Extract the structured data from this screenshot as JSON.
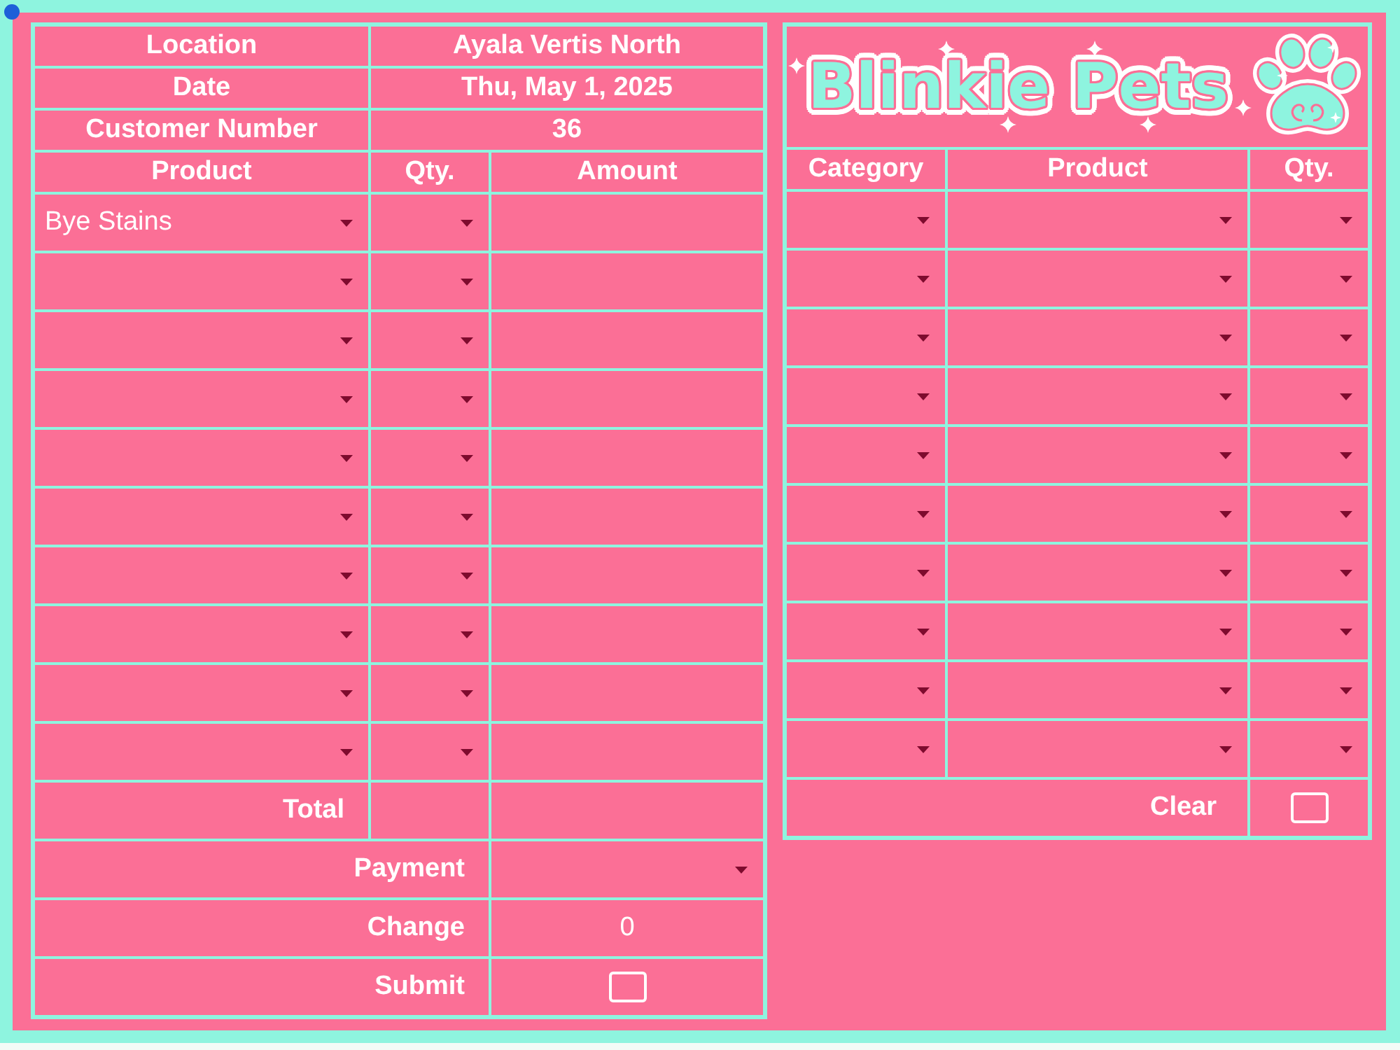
{
  "order_form": {
    "details": [
      {
        "label": "Location",
        "value": "Ayala Vertis North"
      },
      {
        "label": "Date",
        "value": "Thu, May 1, 2025"
      },
      {
        "label": "Customer Number",
        "value": "36"
      }
    ],
    "columns": [
      "Product",
      "Qty.",
      "Amount"
    ],
    "rows": [
      {
        "product": "Bye Stains"
      },
      {},
      {},
      {},
      {},
      {},
      {},
      {},
      {},
      {}
    ],
    "total": {
      "label": "Total"
    },
    "payment": {
      "label": "Payment"
    },
    "change": {
      "label": "Change",
      "value": "0"
    },
    "submit": {
      "label": "Submit",
      "checked": false
    }
  },
  "cart": {
    "logo": "Blinkie Pets",
    "columns": [
      "Category",
      "Product",
      "Qty."
    ],
    "rows": [
      {},
      {},
      {},
      {},
      {},
      {},
      {},
      {},
      {},
      {}
    ],
    "clear": {
      "label": "Clear",
      "checked": false
    }
  }
}
